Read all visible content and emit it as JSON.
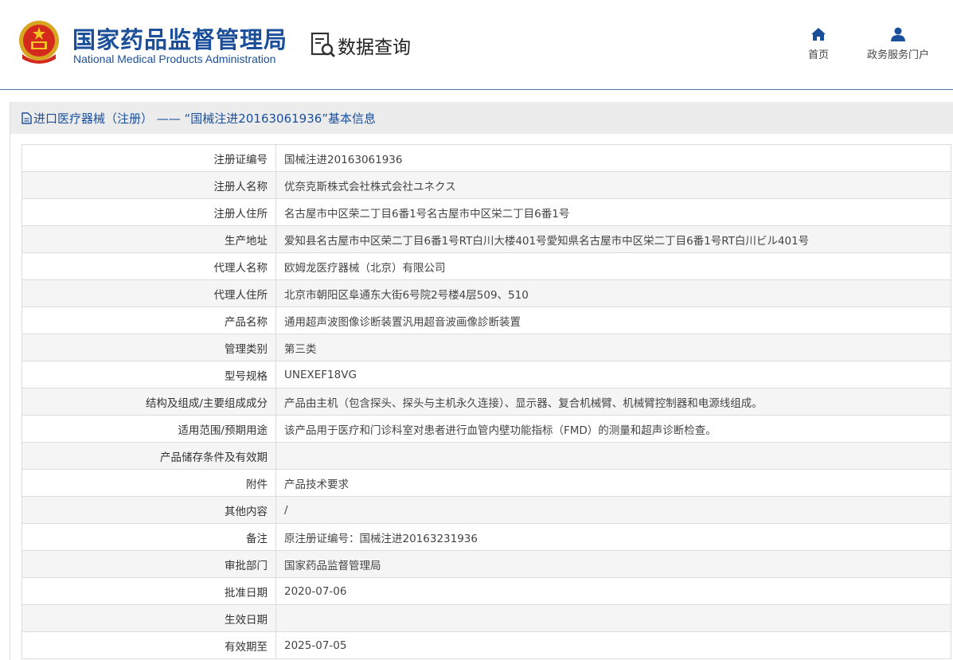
{
  "header": {
    "org_name_cn": "国家药品监督管理局",
    "org_name_en": "National Medical Products Administration",
    "emblem_icon": "national-emblem-icon",
    "section_icon": "document-search-icon",
    "section_title": "数据查询",
    "nav": [
      {
        "label": "首页",
        "icon": "home-icon"
      },
      {
        "label": "政务服务门户",
        "icon": "user-icon"
      }
    ]
  },
  "colors": {
    "brand_blue": "#1b4f9a",
    "title_bar": "#ececec",
    "row_alt": "#f5f5f5"
  },
  "panel": {
    "title_icon": "document-icon",
    "title": "进口医疗器械（注册） —— “国械注进20163061936”基本信息"
  },
  "table": {
    "rows": [
      {
        "label": "注册证编号",
        "value": "国械注进20163061936"
      },
      {
        "label": "注册人名称",
        "value": "优奈克斯株式会社株式会社ユネクス"
      },
      {
        "label": "注册人住所",
        "value": "名古屋市中区荣二丁目6番1号名古屋市中区栄二丁目6番1号"
      },
      {
        "label": "生产地址",
        "value": "爱知县名古屋市中区荣二丁目6番1号RT白川大楼401号愛知県名古屋市中区栄二丁目6番1号RT白川ビル401号"
      },
      {
        "label": "代理人名称",
        "value": "欧姆龙医疗器械（北京）有限公司"
      },
      {
        "label": "代理人住所",
        "value": "北京市朝阳区阜通东大街6号院2号楼4层509、510"
      },
      {
        "label": "产品名称",
        "value": "通用超声波图像诊断装置汎用超音波画像診断装置"
      },
      {
        "label": "管理类别",
        "value": "第三类"
      },
      {
        "label": "型号规格",
        "value": "UNEXEF18VG"
      },
      {
        "label": "结构及组成/主要组成成分",
        "value": "产品由主机（包含探头、探头与主机永久连接）、显示器、复合机械臂、机械臂控制器和电源线组成。"
      },
      {
        "label": "适用范围/预期用途",
        "value": "该产品用于医疗和门诊科室对患者进行血管内壁功能指标（FMD）的测量和超声诊断检查。"
      },
      {
        "label": "产品储存条件及有效期",
        "value": ""
      },
      {
        "label": "附件",
        "value": "产品技术要求"
      },
      {
        "label": "其他内容",
        "value": "/"
      },
      {
        "label": "备注",
        "value": "原注册证编号：国械注进20163231936"
      },
      {
        "label": "审批部门",
        "value": "国家药品监督管理局"
      },
      {
        "label": "批准日期",
        "value": "2020-07-06"
      },
      {
        "label": "生效日期",
        "value": ""
      },
      {
        "label": "有效期至",
        "value": "2025-07-05"
      }
    ]
  }
}
